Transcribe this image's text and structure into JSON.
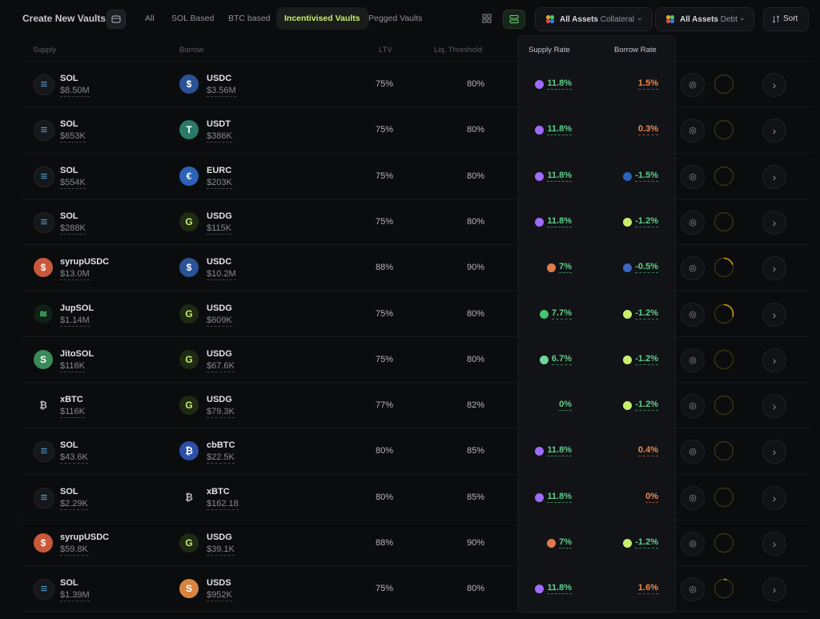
{
  "header": {
    "title": "Create New Vaults",
    "tabs": [
      "All",
      "SOL Based",
      "BTC based",
      "Incentivised Vaults",
      "Pegged Vaults"
    ],
    "active_tab": "Incentivised Vaults",
    "collateral_filter": {
      "label": "All Assets",
      "sub": "Collateral"
    },
    "debt_filter": {
      "label": "All Assets",
      "sub": "Debt"
    },
    "sort_label": "Sort"
  },
  "columns": {
    "supply": "Supply",
    "borrow": "Borrow",
    "ltv": "LTV",
    "liq": "Liq. Threshold",
    "supply_rate": "Supply Rate",
    "borrow_rate": "Borrow Rate"
  },
  "icons": {
    "vault_button": "vault-icon",
    "grid_view": "grid-view-icon",
    "list_view": "list-view-icon",
    "sort": "sort-icon",
    "chevron": "chevron-right-icon",
    "globe": "globe-icon"
  },
  "colors": {
    "accent": "#c8ef6c",
    "green_rate": "#5fd08a",
    "orange_rate": "#f08a4b",
    "ring": "#c9a10d"
  },
  "rows": [
    {
      "supply_sym": "SOL",
      "supply_amt": "$8.50M",
      "borrow_sym": "USDC",
      "borrow_amt": "$3.56M",
      "ltv": "75%",
      "liq": "80%",
      "supply_rate": "11.8%",
      "borrow_rate": "1.5%",
      "borrow_tone": "orange",
      "s_coin": "sol",
      "b_coin": "usdc",
      "s_mini": "sol",
      "b_mini": "",
      "fill": 0
    },
    {
      "supply_sym": "SOL",
      "supply_amt": "$653K",
      "borrow_sym": "USDT",
      "borrow_amt": "$386K",
      "ltv": "75%",
      "liq": "80%",
      "supply_rate": "11.8%",
      "borrow_rate": "0.3%",
      "borrow_tone": "orange",
      "s_coin": "sol",
      "b_coin": "usdt",
      "s_mini": "sol",
      "b_mini": "",
      "fill": 0
    },
    {
      "supply_sym": "SOL",
      "supply_amt": "$554K",
      "borrow_sym": "EURC",
      "borrow_amt": "$203K",
      "ltv": "75%",
      "liq": "80%",
      "supply_rate": "11.8%",
      "borrow_rate": "-1.5%",
      "borrow_tone": "green",
      "s_coin": "sol",
      "b_coin": "eurc",
      "s_mini": "sol",
      "b_mini": "eurc",
      "fill": 0
    },
    {
      "supply_sym": "SOL",
      "supply_amt": "$288K",
      "borrow_sym": "USDG",
      "borrow_amt": "$115K",
      "ltv": "75%",
      "liq": "80%",
      "supply_rate": "11.8%",
      "borrow_rate": "-1.2%",
      "borrow_tone": "green",
      "s_coin": "sol",
      "b_coin": "usdg",
      "s_mini": "sol",
      "b_mini": "usdg",
      "fill": 0
    },
    {
      "supply_sym": "syrupUSDC",
      "supply_amt": "$13.0M",
      "borrow_sym": "USDC",
      "borrow_amt": "$10.2M",
      "ltv": "88%",
      "liq": "90%",
      "supply_rate": "7%",
      "borrow_rate": "-0.5%",
      "borrow_tone": "green",
      "s_coin": "syrup",
      "b_coin": "usdc",
      "s_mini": "syrup",
      "b_mini": "usdc",
      "fill": 0.2
    },
    {
      "supply_sym": "JupSOL",
      "supply_amt": "$1.14M",
      "borrow_sym": "USDG",
      "borrow_amt": "$609K",
      "ltv": "75%",
      "liq": "80%",
      "supply_rate": "7.7%",
      "borrow_rate": "-1.2%",
      "borrow_tone": "green",
      "s_coin": "jupsol",
      "b_coin": "usdg",
      "s_mini": "jupsol",
      "b_mini": "usdg",
      "fill": 0.3
    },
    {
      "supply_sym": "JitoSOL",
      "supply_amt": "$116K",
      "borrow_sym": "USDG",
      "borrow_amt": "$67.6K",
      "ltv": "75%",
      "liq": "80%",
      "supply_rate": "6.7%",
      "borrow_rate": "-1.2%",
      "borrow_tone": "green",
      "s_coin": "jitosol",
      "b_coin": "usdg",
      "s_mini": "jitosol",
      "b_mini": "usdg",
      "fill": 0
    },
    {
      "supply_sym": "xBTC",
      "supply_amt": "$116K",
      "borrow_sym": "USDG",
      "borrow_amt": "$79.3K",
      "ltv": "77%",
      "liq": "82%",
      "supply_rate": "0%",
      "borrow_rate": "-1.2%",
      "borrow_tone": "green",
      "s_coin": "xbtc",
      "b_coin": "usdg",
      "s_mini": "",
      "b_mini": "usdg",
      "fill": 0
    },
    {
      "supply_sym": "SOL",
      "supply_amt": "$43.6K",
      "borrow_sym": "cbBTC",
      "borrow_amt": "$22.5K",
      "ltv": "80%",
      "liq": "85%",
      "supply_rate": "11.8%",
      "borrow_rate": "0.4%",
      "borrow_tone": "orange",
      "s_coin": "sol",
      "b_coin": "cbbtc",
      "s_mini": "sol",
      "b_mini": "",
      "fill": 0
    },
    {
      "supply_sym": "SOL",
      "supply_amt": "$2.29K",
      "borrow_sym": "xBTC",
      "borrow_amt": "$162.18",
      "ltv": "80%",
      "liq": "85%",
      "supply_rate": "11.8%",
      "borrow_rate": "0%",
      "borrow_tone": "orange",
      "s_coin": "sol",
      "b_coin": "xbtc",
      "s_mini": "sol",
      "b_mini": "",
      "fill": 0
    },
    {
      "supply_sym": "syrupUSDC",
      "supply_amt": "$59.8K",
      "borrow_sym": "USDG",
      "borrow_amt": "$39.1K",
      "ltv": "88%",
      "liq": "90%",
      "supply_rate": "7%",
      "borrow_rate": "-1.2%",
      "borrow_tone": "green",
      "s_coin": "syrup",
      "b_coin": "usdg",
      "s_mini": "syrup",
      "b_mini": "usdg",
      "fill": 0
    },
    {
      "supply_sym": "SOL",
      "supply_amt": "$1.39M",
      "borrow_sym": "USDS",
      "borrow_amt": "$952K",
      "ltv": "75%",
      "liq": "80%",
      "supply_rate": "11.8%",
      "borrow_rate": "1.6%",
      "borrow_tone": "orange",
      "s_coin": "sol",
      "b_coin": "usds",
      "s_mini": "sol",
      "b_mini": "",
      "fill": 0.05
    }
  ]
}
